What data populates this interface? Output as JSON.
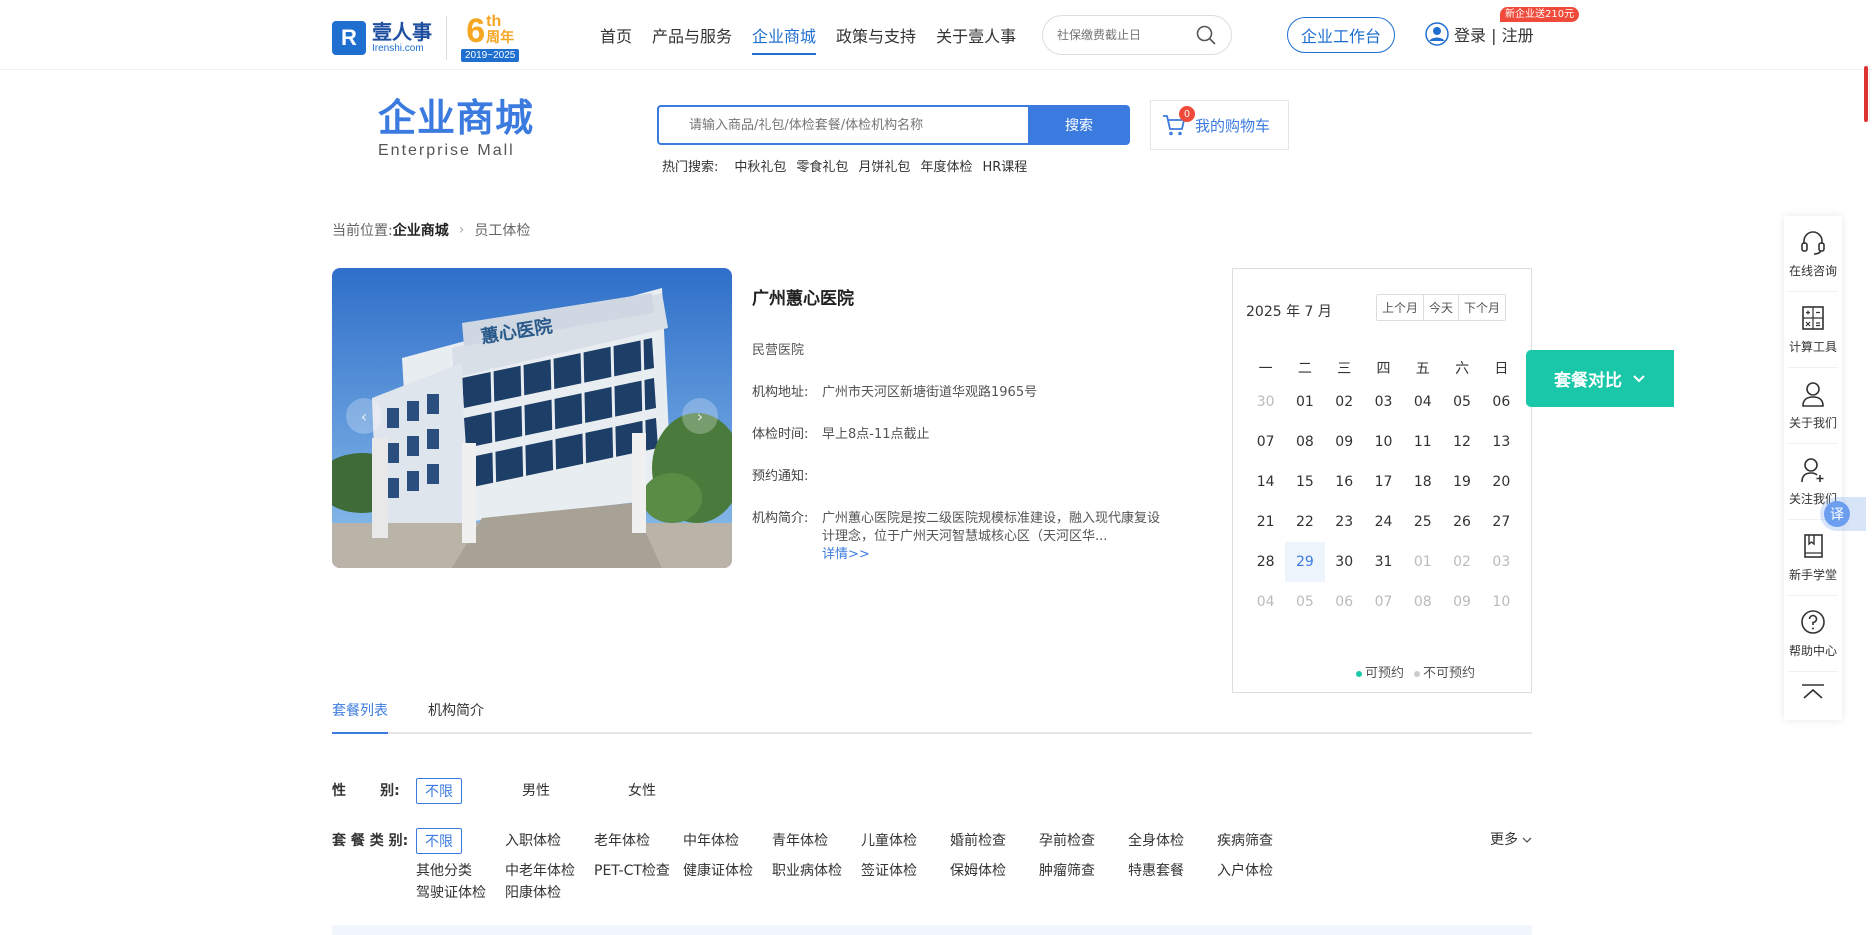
{
  "header": {
    "logo_cn": "壹人事",
    "logo_en": "Irenshi.com",
    "anniv_num": "6",
    "anniv_th": "th",
    "anniv_cn": "周年",
    "anniv_years": "2019~2025",
    "nav": [
      {
        "label": "首页",
        "active": false
      },
      {
        "label": "产品与服务",
        "active": false
      },
      {
        "label": "企业商城",
        "active": true
      },
      {
        "label": "政策与支持",
        "active": false
      },
      {
        "label": "关于壹人事",
        "active": false
      }
    ],
    "search_placeholder": "社保缴费截止日",
    "workbench_label": "企业工作台",
    "login_label": "登录 | 注册",
    "promo_badge": "新企业送210元"
  },
  "mall": {
    "title_cn": "企业商城",
    "title_en": "Enterprise  Mall",
    "search_placeholder": "请输入商品/礼包/体检套餐/体检机构名称",
    "search_button": "搜索",
    "cart_label": "我的购物车",
    "cart_count": "0",
    "hot_label": "热门搜索:",
    "hot_items": [
      "中秋礼包",
      "零食礼包",
      "月饼礼包",
      "年度体检",
      "HR课程"
    ]
  },
  "breadcrumb": {
    "prefix": "当前位置:",
    "level1": "企业商城",
    "level2": "员工体检"
  },
  "hospital": {
    "name": "广州蕙心医院",
    "type": "民营医院",
    "address_label": "机构地址:",
    "address": "广州市天河区新塘街道华观路1965号",
    "hours_label": "体检时间:",
    "hours": "早上8点-11点截止",
    "notice_label": "预约通知:",
    "notice": "",
    "intro_label": "机构简介:",
    "intro": "广州蕙心医院是按二级医院规模标准建设，融入现代康复设计理念，位于广州天河智慧城核心区（天河区华...",
    "more_link": "详情>>",
    "sign_text": "蕙心医院"
  },
  "calendar": {
    "title": "2025 年 7 月",
    "prev_label": "上个月",
    "today_label": "今天",
    "next_label": "下个月",
    "weekdays": [
      "一",
      "二",
      "三",
      "四",
      "五",
      "六",
      "日"
    ],
    "days": [
      {
        "d": "30",
        "muted": true
      },
      {
        "d": "01"
      },
      {
        "d": "02"
      },
      {
        "d": "03"
      },
      {
        "d": "04"
      },
      {
        "d": "05"
      },
      {
        "d": "06"
      },
      {
        "d": "07"
      },
      {
        "d": "08"
      },
      {
        "d": "09"
      },
      {
        "d": "10"
      },
      {
        "d": "11"
      },
      {
        "d": "12"
      },
      {
        "d": "13"
      },
      {
        "d": "14"
      },
      {
        "d": "15"
      },
      {
        "d": "16"
      },
      {
        "d": "17"
      },
      {
        "d": "18"
      },
      {
        "d": "19"
      },
      {
        "d": "20"
      },
      {
        "d": "21"
      },
      {
        "d": "22"
      },
      {
        "d": "23"
      },
      {
        "d": "24"
      },
      {
        "d": "25"
      },
      {
        "d": "26"
      },
      {
        "d": "27"
      },
      {
        "d": "28"
      },
      {
        "d": "29",
        "today": true
      },
      {
        "d": "30"
      },
      {
        "d": "31"
      },
      {
        "d": "01",
        "muted": true
      },
      {
        "d": "02",
        "muted": true
      },
      {
        "d": "03",
        "muted": true
      },
      {
        "d": "04",
        "muted": true
      },
      {
        "d": "05",
        "muted": true
      },
      {
        "d": "06",
        "muted": true
      },
      {
        "d": "07",
        "muted": true
      },
      {
        "d": "08",
        "muted": true
      },
      {
        "d": "09",
        "muted": true
      },
      {
        "d": "10",
        "muted": true
      }
    ],
    "legend_available": "可预约",
    "legend_unavailable": "不可预约",
    "available_color": "#1ac7a9",
    "unavailable_color": "#cccccc"
  },
  "compare_label": "套餐对比",
  "right_bar": [
    {
      "label": "在线咨询",
      "icon": "headset-icon"
    },
    {
      "label": "计算工具",
      "icon": "calculator-icon"
    },
    {
      "label": "关于我们",
      "icon": "person-icon"
    },
    {
      "label": "关注我们",
      "icon": "person-add-icon"
    },
    {
      "label": "新手学堂",
      "icon": "book-icon"
    },
    {
      "label": "帮助中心",
      "icon": "question-icon"
    }
  ],
  "translate_label": "译",
  "tabs": [
    {
      "label": "套餐列表",
      "active": true
    },
    {
      "label": "机构简介",
      "active": false
    }
  ],
  "filters": {
    "gender_label": "性       别:",
    "gender_options": [
      "不限",
      "男性",
      "女性"
    ],
    "category_label": "套 餐 类 别:",
    "category_row1": [
      "不限",
      "入职体检",
      "老年体检",
      "中年体检",
      "青年体检",
      "儿童体检",
      "婚前检查",
      "孕前检查",
      "全身体检",
      "疾病筛查"
    ],
    "category_row2": [
      "其他分类",
      "中老年体检",
      "PET-CT检查",
      "健康证体检",
      "职业病体检",
      "签证体检",
      "保姆体检",
      "肿瘤筛查",
      "特惠套餐",
      "入户体检"
    ],
    "category_row3": [
      "驾驶证体检",
      "阳康体检"
    ],
    "more_label": "更多"
  }
}
